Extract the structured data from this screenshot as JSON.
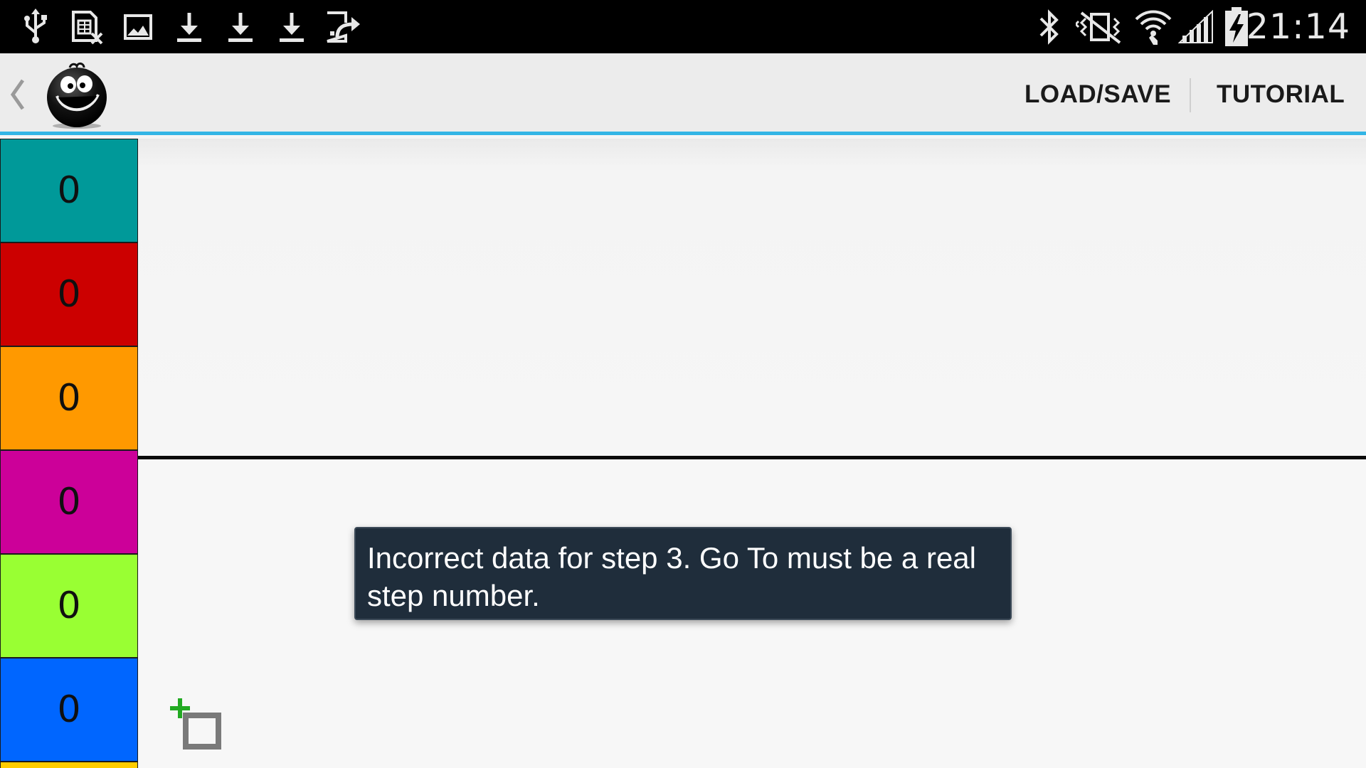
{
  "status_bar": {
    "time": "21:14",
    "left_icons": [
      "usb-icon",
      "sim-missing-icon",
      "image-icon",
      "download-icon",
      "download-icon",
      "download-icon",
      "device-export-icon"
    ],
    "right_icons": [
      "bluetooth-icon",
      "vibrate-icon",
      "wifi-icon",
      "signal-icon",
      "battery-charging-icon"
    ]
  },
  "action_bar": {
    "back_icon": "chevron-left-icon",
    "logo_icon": "smiley-face-icon",
    "load_save_label": "LOAD/SAVE",
    "tutorial_label": "TUTORIAL",
    "accent_color": "#33b5e5"
  },
  "counters": [
    {
      "value": "0",
      "color": "#009999"
    },
    {
      "value": "0",
      "color": "#cc0000"
    },
    {
      "value": "0",
      "color": "#ff9900"
    },
    {
      "value": "0",
      "color": "#cc0099"
    },
    {
      "value": "0",
      "color": "#99ff33"
    },
    {
      "value": "0",
      "color": "#0066ff"
    }
  ],
  "toast": {
    "message": "Incorrect data for step 3. Go To must be a real step number."
  },
  "workspace": {
    "add_icon": "add-step-icon"
  }
}
